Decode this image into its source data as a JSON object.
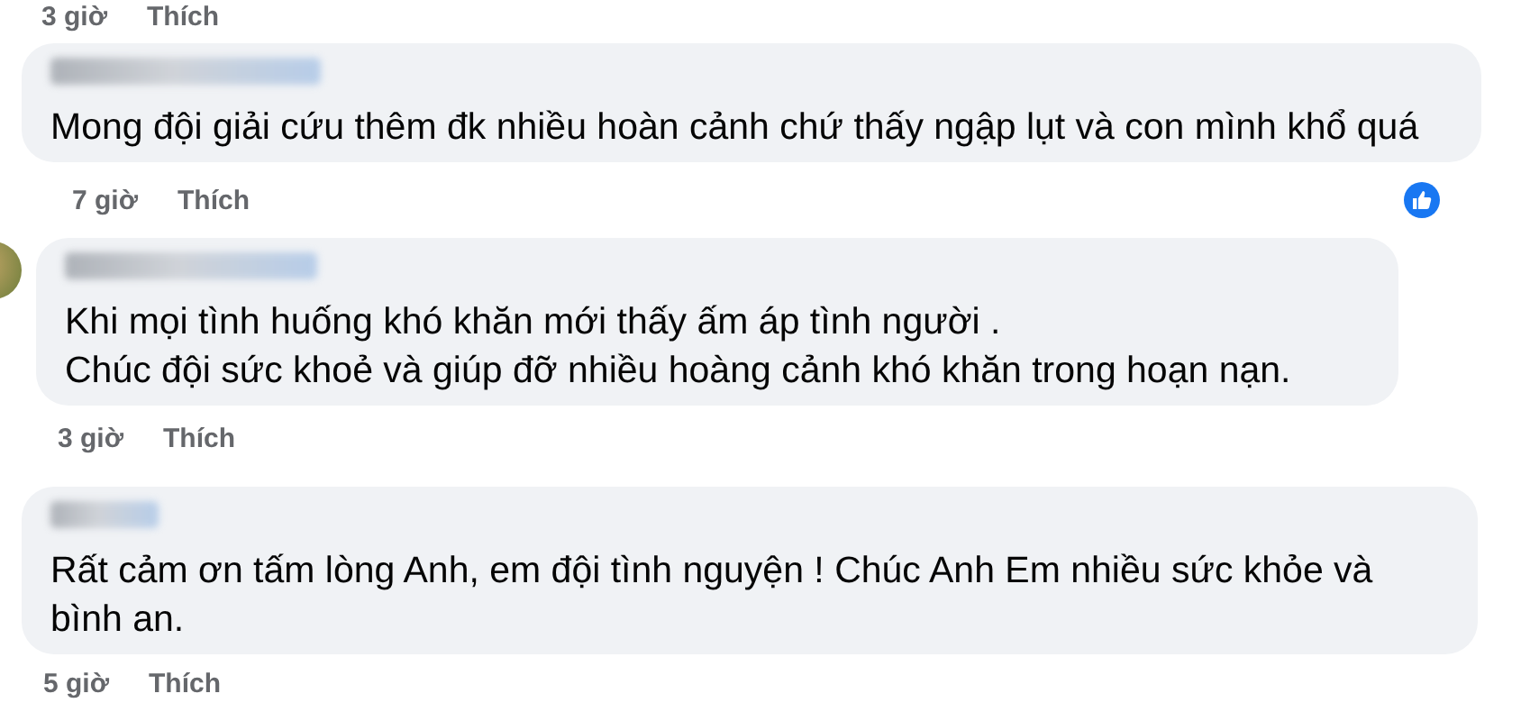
{
  "top_footer": {
    "time": "3 giờ",
    "like_label": "Thích"
  },
  "comments": [
    {
      "avatar_shown": false,
      "text": "Mong đội giải cứu thêm đk nhiều hoàn cảnh chứ thấy ngập lụt và con mình khổ quá",
      "time": "7 giờ",
      "like_label": "Thích",
      "liked": true
    },
    {
      "avatar_shown": true,
      "text": "Khi mọi tình huống khó khăn mới thấy ấm áp tình người .\nChúc đội sức khoẻ và giúp đỡ nhiều hoàng cảnh khó khăn trong hoạn nạn.",
      "time": "3 giờ",
      "like_label": "Thích",
      "liked": false
    },
    {
      "avatar_shown": false,
      "text": "Rất cảm ơn tấm lòng Anh, em đội tình nguyện ! Chúc Anh Em nhiều sức khỏe và bình an.",
      "time": "5 giờ",
      "like_label": "Thích",
      "liked": false
    }
  ]
}
